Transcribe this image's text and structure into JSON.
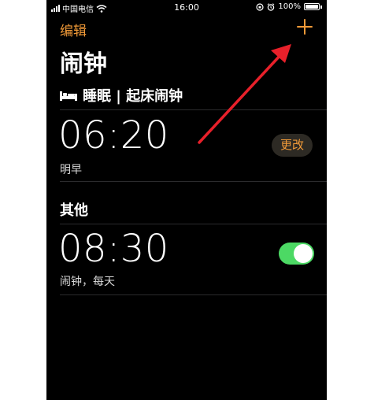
{
  "status_bar": {
    "carrier": "中国电信",
    "time": "16:00",
    "battery": "100%"
  },
  "nav": {
    "edit_label": "编辑",
    "add_icon": "plus-icon"
  },
  "title": "闹钟",
  "sleep_section": {
    "icon": "bed-icon",
    "heading": "睡眠 | 起床闹钟",
    "alarm": {
      "time": "06:20",
      "label": "明早",
      "button_label": "更改"
    }
  },
  "other_section": {
    "heading": "其他",
    "alarms": [
      {
        "time": "08:30",
        "label": "闹钟，每天",
        "enabled": true
      }
    ]
  },
  "colors": {
    "accent": "#f19a38",
    "toggle_on": "#4cd964",
    "background": "#000000",
    "annotation_arrow": "#e8202a"
  }
}
